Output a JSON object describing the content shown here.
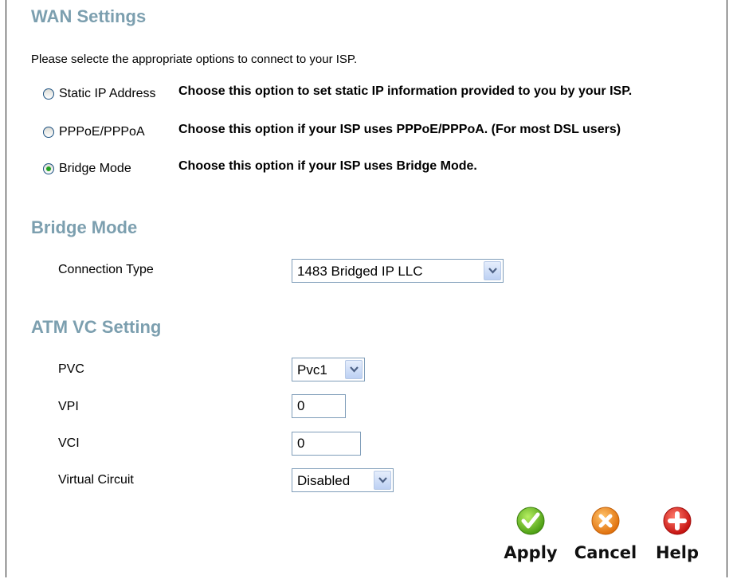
{
  "wan_settings": {
    "title": "WAN Settings",
    "intro": "Please selecte the appropriate options to connect to your ISP.",
    "options": [
      {
        "label": "Static IP Address",
        "description": "Choose this option to set static IP information provided to you by your ISP.",
        "selected": false
      },
      {
        "label": "PPPoE/PPPoA",
        "description": "Choose this option if your ISP uses PPPoE/PPPoA. (For most DSL users)",
        "selected": false
      },
      {
        "label": "Bridge Mode",
        "description": "Choose this option if your ISP uses Bridge Mode.",
        "selected": true
      }
    ]
  },
  "bridge_mode": {
    "title": "Bridge Mode",
    "connection_type_label": "Connection Type",
    "connection_type_value": "1483 Bridged IP LLC"
  },
  "atm_vc": {
    "title": "ATM VC Setting",
    "pvc_label": "PVC",
    "pvc_value": "Pvc1",
    "vpi_label": "VPI",
    "vpi_value": "0",
    "vci_label": "VCI",
    "vci_value": "0",
    "virtual_circuit_label": "Virtual Circuit",
    "virtual_circuit_value": "Disabled"
  },
  "actions": {
    "apply": "Apply",
    "cancel": "Cancel",
    "help": "Help"
  },
  "colors": {
    "section_title": "#7C9FAF",
    "apply": "#5FB31B",
    "cancel": "#F08A1C",
    "help": "#D9201E"
  }
}
